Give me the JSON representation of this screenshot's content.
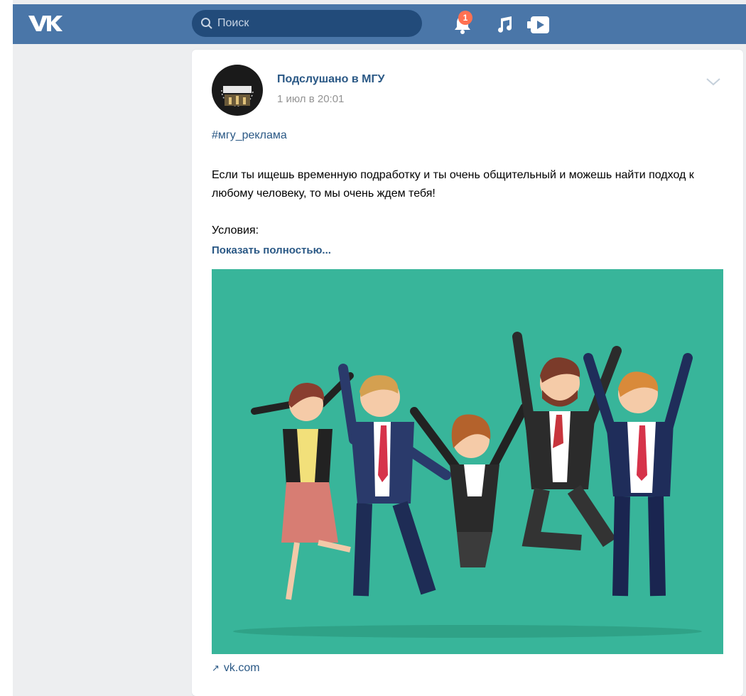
{
  "header": {
    "logo": "vk-logo",
    "search": {
      "placeholder": "Поиск"
    },
    "notifications": {
      "count": "1"
    },
    "icons": [
      "bell-icon",
      "music-icon",
      "video-icon"
    ],
    "colors": {
      "bar": "#4a76a8",
      "search_bg": "#224b7a",
      "badge": "#ff7152"
    }
  },
  "post": {
    "author": "Подслушано в МГУ",
    "date": "1 июл в 20:01",
    "hashtag": "#мгу_реклама",
    "text": "Если ты ищешь временную подработку и ты очень общительный и можешь найти подход к любому человеку, то мы очень ждем тебя!",
    "conditions": "Условия:",
    "show_more": "Показать полностью...",
    "link": "vk.com",
    "image_bg": "#38b59a"
  }
}
